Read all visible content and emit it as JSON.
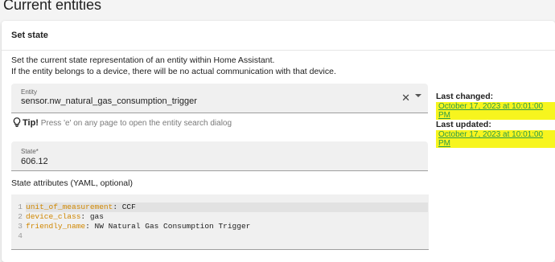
{
  "page_title": "Current entities",
  "card": {
    "title": "Set state",
    "description_line1": "Set the current state representation of an entity within Home Assistant.",
    "description_line2": "If the entity belongs to a device, there will be no actual communication with that device."
  },
  "entity_field": {
    "label": "Entity",
    "value": "sensor.nw_natural_gas_consumption_trigger"
  },
  "tip": {
    "bold": "Tip!",
    "text": " Press 'e' on any page to open the entity search dialog"
  },
  "state_field": {
    "label": "State*",
    "value": "606.12"
  },
  "attributes": {
    "title": "State attributes (YAML, optional)",
    "lines": [
      {
        "num": "1",
        "key": "unit_of_measurement",
        "value": "CCF"
      },
      {
        "num": "2",
        "key": "device_class",
        "value": "gas"
      },
      {
        "num": "3",
        "key": "friendly_name",
        "value": "NW Natural Gas Consumption Trigger"
      },
      {
        "num": "4",
        "key": "",
        "value": ""
      }
    ]
  },
  "last_changed": {
    "label": "Last changed:",
    "value": "October 17, 2023 at 10:01:00 PM"
  },
  "last_updated": {
    "label": "Last updated:",
    "value": "October 17, 2023 at 10:01:00 PM"
  },
  "colors": {
    "highlight": "#f7f51e",
    "link": "#2e9b4a",
    "yaml_key": "#d08700"
  }
}
